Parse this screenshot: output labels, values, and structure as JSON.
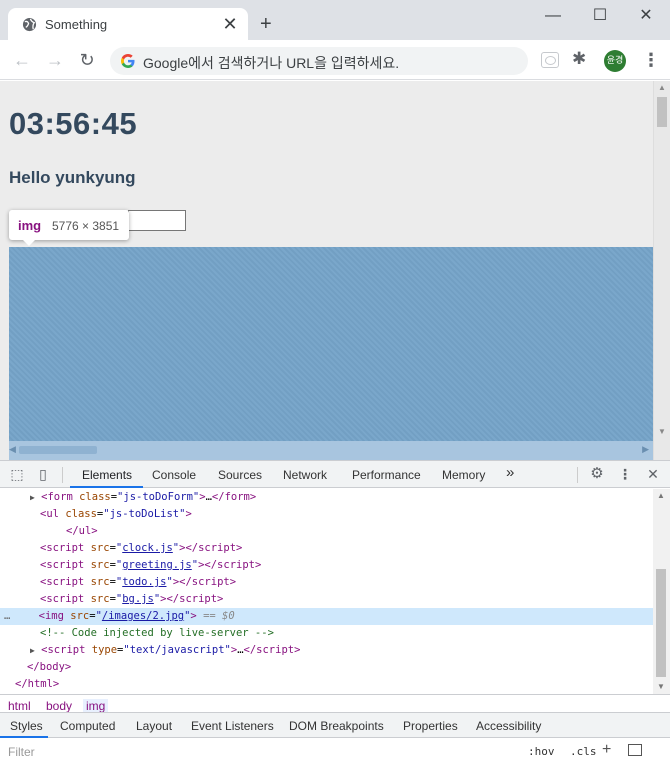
{
  "browser": {
    "tab_title": "Something",
    "tab_close": "✕",
    "new_tab": "+",
    "window": {
      "minimize": "—",
      "maximize": "☐",
      "close": "✕"
    },
    "omnibox_placeholder": "Google에서 검색하거나 URL을 입력하세요.",
    "avatar_text": "윤경",
    "menu": "⋮"
  },
  "page": {
    "clock": "03:56:45",
    "greeting": "Hello yunkyung",
    "image_tooltip": {
      "tag": "img",
      "size": "5776 × 3851"
    },
    "image_color": "#76a4c9"
  },
  "devtools": {
    "tabs": [
      "Elements",
      "Console",
      "Sources",
      "Network",
      "Performance",
      "Memory"
    ],
    "more": "»",
    "dom": {
      "form_line": {
        "tag": "form",
        "class_attr": "class",
        "class_val": "js-toDoForm",
        "ellipsis": "…"
      },
      "ul_line": {
        "tag": "ul",
        "class_attr": "class",
        "class_val": "js-toDoList"
      },
      "ul_close": "</ul>",
      "scripts": [
        {
          "src": "clock.js"
        },
        {
          "src": "greeting.js"
        },
        {
          "src": "todo.js"
        },
        {
          "src": "bg.js"
        }
      ],
      "img_line": {
        "src": "/images/2.jpg",
        "suffix": "== $0"
      },
      "comment": "<!-- Code injected by live-server -->",
      "script_inline": {
        "type": "text/javascript",
        "ellipsis": "…"
      },
      "body_close": "</body>",
      "html_close": "</html>",
      "line_marker": "…"
    },
    "breadcrumbs": [
      "html",
      "body",
      "img"
    ],
    "sub_tabs": [
      "Styles",
      "Computed",
      "Layout",
      "Event Listeners",
      "DOM Breakpoints",
      "Properties",
      "Accessibility"
    ],
    "filter_placeholder": "Filter",
    "hov": ":hov",
    "cls": ".cls",
    "add": "+"
  }
}
